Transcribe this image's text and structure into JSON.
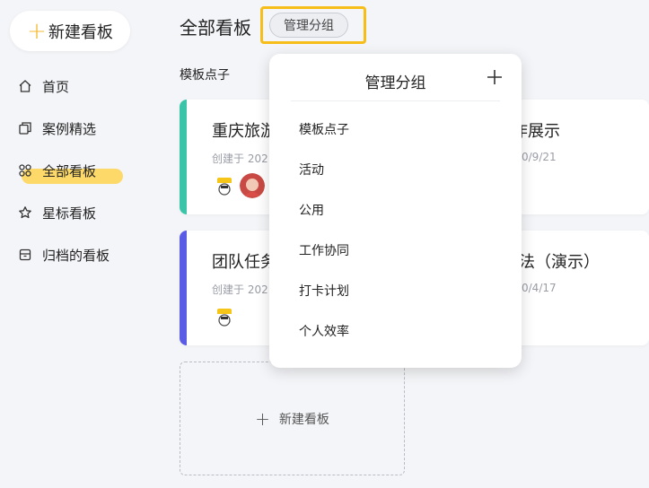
{
  "sidebar": {
    "new_board_label": "新建看板",
    "items": [
      {
        "label": "首页",
        "icon": "home-icon"
      },
      {
        "label": "案例精选",
        "icon": "copy-icon"
      },
      {
        "label": "全部看板",
        "icon": "grid-icon",
        "active": true
      },
      {
        "label": "星标看板",
        "icon": "star-icon"
      },
      {
        "label": "归档的看板",
        "icon": "archive-icon"
      }
    ]
  },
  "header": {
    "title": "全部看板",
    "manage_button_label": "管理分组"
  },
  "group": {
    "title": "模板点子"
  },
  "cards": [
    {
      "title": "重庆旅游",
      "date": "创建于 202",
      "accent": "#3cc4a9"
    },
    {
      "title": "作展示",
      "date": "0/9/21",
      "accent": null
    },
    {
      "title": "团队任务",
      "date": "创建于 202",
      "accent": "#5a5ce6"
    },
    {
      "title": "法（演示）",
      "date": "0/4/17",
      "accent": null
    }
  ],
  "new_board_card_label": "新建看板",
  "dropdown": {
    "title": "管理分组",
    "items": [
      "模板点子",
      "活动",
      "公用",
      "工作协同",
      "打卡计划",
      "个人效率"
    ]
  },
  "colors": {
    "accent_yellow": "#f7bd18",
    "highlight": "#fdd96a",
    "background": "#f4f5f8"
  }
}
